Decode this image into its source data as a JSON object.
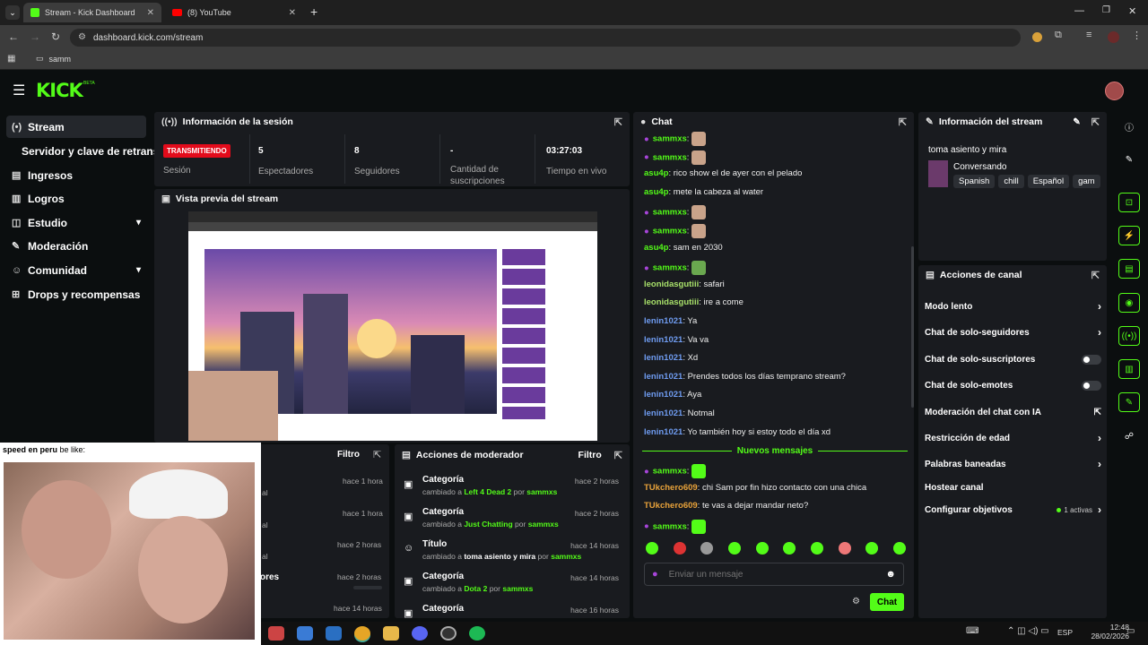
{
  "browser": {
    "tabs": [
      {
        "label": "Stream - Kick Dashboard",
        "active": true
      },
      {
        "label": "(8) YouTube",
        "active": false
      }
    ],
    "url": "dashboard.kick.com/stream",
    "bookmark": "samm"
  },
  "sidebar": {
    "items": [
      {
        "label": "Stream",
        "icon": "broadcast-icon",
        "active": true
      },
      {
        "label": "Servidor y clave de retransmisión",
        "icon": "",
        "active": false
      },
      {
        "label": "Ingresos",
        "icon": "dollar-icon"
      },
      {
        "label": "Logros",
        "icon": "trophy-icon"
      },
      {
        "label": "Estudio",
        "icon": "studio-icon",
        "expand": true
      },
      {
        "label": "Moderación",
        "icon": "wrench-icon"
      },
      {
        "label": "Comunidad",
        "icon": "users-icon",
        "expand": true
      },
      {
        "label": "Drops y recompensas",
        "icon": "gift-icon"
      }
    ]
  },
  "session": {
    "title": "Información de la sesión",
    "status_badge": "TRANSMITIENDO",
    "status_label": "Sesión",
    "viewers": "5",
    "viewers_label": "Espectadores",
    "followers": "8",
    "followers_label": "Seguidores",
    "subs": "-",
    "subs_label": "Cantidad de suscripciones",
    "uptime": "03:27:03",
    "uptime_label": "Tiempo en vivo"
  },
  "preview": {
    "title": "Vista previa del stream"
  },
  "overlay": {
    "caption_bold": "speed en peru",
    "caption_rest": " be like:"
  },
  "left_panel": {
    "filter": "Filtro",
    "times": [
      "hace 1 hora",
      "hace 1 hora",
      "hace 2 horas",
      "hace 2 horas",
      "hace 14 horas"
    ],
    "partial_text": [
      "al",
      "al",
      "al",
      "ores"
    ]
  },
  "mod_actions": {
    "title": "Acciones de moderador",
    "filter": "Filtro",
    "items": [
      {
        "title": "Categoría",
        "changed": "cambiado a",
        "value": "Left 4 Dead 2",
        "by": "por",
        "user": "sammxs",
        "time": "hace 2 horas"
      },
      {
        "title": "Categoría",
        "changed": "cambiado a",
        "value": "Just Chatting",
        "by": "por",
        "user": "sammxs",
        "time": "hace 2 horas"
      },
      {
        "title": "Título",
        "changed": "cambiado a",
        "value": "toma asiento y mira",
        "by": "por",
        "user": "sammxs",
        "time": "hace 14 horas"
      },
      {
        "title": "Categoría",
        "changed": "cambiado a",
        "value": "Dota 2",
        "by": "por",
        "user": "sammxs",
        "time": "hace 14 horas"
      },
      {
        "title": "Categoría",
        "changed": "",
        "value": "",
        "by": "",
        "user": "",
        "time": "hace 16 horas"
      }
    ]
  },
  "chat": {
    "title": "Chat",
    "messages": [
      {
        "user": "sammxs",
        "text": "",
        "cls": "u-g",
        "mic": true,
        "emote": true
      },
      {
        "user": "sammxs",
        "text": "",
        "cls": "u-g",
        "mic": true,
        "emote": true
      },
      {
        "user": "asu4p",
        "text": ": rico show el de ayer con el pelado",
        "cls": "u-g"
      },
      {
        "user": "asu4p",
        "text": ": mete la cabeza al water",
        "cls": "u-g"
      },
      {
        "user": "sammxs",
        "text": "",
        "cls": "u-g",
        "mic": true,
        "emote": true
      },
      {
        "user": "sammxs",
        "text": "",
        "cls": "u-g",
        "mic": true,
        "emote": true
      },
      {
        "user": "asu4p",
        "text": ": sam en 2030",
        "cls": "u-g"
      },
      {
        "user": "sammxs",
        "text": "",
        "cls": "u-g",
        "mic": true,
        "emote": true
      },
      {
        "user": "leonidasgutiii",
        "text": ": safari",
        "cls": "u-p"
      },
      {
        "user": "leonidasgutiii",
        "text": ": ire a come",
        "cls": "u-p"
      },
      {
        "user": "lenin1021",
        "text": ": Ya",
        "cls": "u-b"
      },
      {
        "user": "lenin1021",
        "text": ": Va va",
        "cls": "u-b"
      },
      {
        "user": "lenin1021",
        "text": ": Xd",
        "cls": "u-b"
      },
      {
        "user": "lenin1021",
        "text": ": Prendes todos los días temprano stream?",
        "cls": "u-b"
      },
      {
        "user": "lenin1021",
        "text": ": Aya",
        "cls": "u-b"
      },
      {
        "user": "lenin1021",
        "text": ": Notmal",
        "cls": "u-b"
      },
      {
        "user": "lenin1021",
        "text": ": Yo también hoy si estoy todo el día xd",
        "cls": "u-b"
      }
    ],
    "new_messages": "Nuevos mensajes",
    "messages_after": [
      {
        "user": "sammxs",
        "text": "",
        "cls": "u-g",
        "mic": true,
        "emote": true
      },
      {
        "user": "TUkchero609",
        "text": ": chi Sam por fin hizo contacto con una chica",
        "cls": "u-o"
      },
      {
        "user": "TUkchero609",
        "text": ": te vas a dejar mandar neto?",
        "cls": "u-o"
      },
      {
        "user": "sammxs",
        "text": "",
        "cls": "u-g",
        "mic": true,
        "emote": true
      }
    ],
    "placeholder": "Enviar un mensaje",
    "send": "Chat"
  },
  "stream_info": {
    "title": "Información del stream",
    "stream_title": "toma asiento y mira",
    "category": "Conversando",
    "tags": [
      "Spanish",
      "chill",
      "Español",
      "gam"
    ]
  },
  "channel_actions": {
    "title": "Acciones de canal",
    "items": [
      {
        "label": "Modo lento",
        "type": "arrow"
      },
      {
        "label": "Chat de solo-seguidores",
        "type": "arrow"
      },
      {
        "label": "Chat de solo-suscriptores",
        "type": "toggle"
      },
      {
        "label": "Chat de solo-emotes",
        "type": "toggle"
      },
      {
        "label": "Moderación del chat con IA",
        "type": "external"
      },
      {
        "label": "Restricción de edad",
        "type": "arrow"
      },
      {
        "label": "Palabras baneadas",
        "type": "arrow"
      },
      {
        "label": "Hostear canal",
        "type": "none"
      },
      {
        "label": "Configurar objetivos",
        "type": "arrow",
        "extra": "1 activas"
      }
    ]
  },
  "taskbar": {
    "lang": "ESP",
    "time": "12:48",
    "date": "28/02/2026"
  },
  "colors": {
    "kick_green": "#53fc18",
    "live_red": "#e30b1b"
  }
}
